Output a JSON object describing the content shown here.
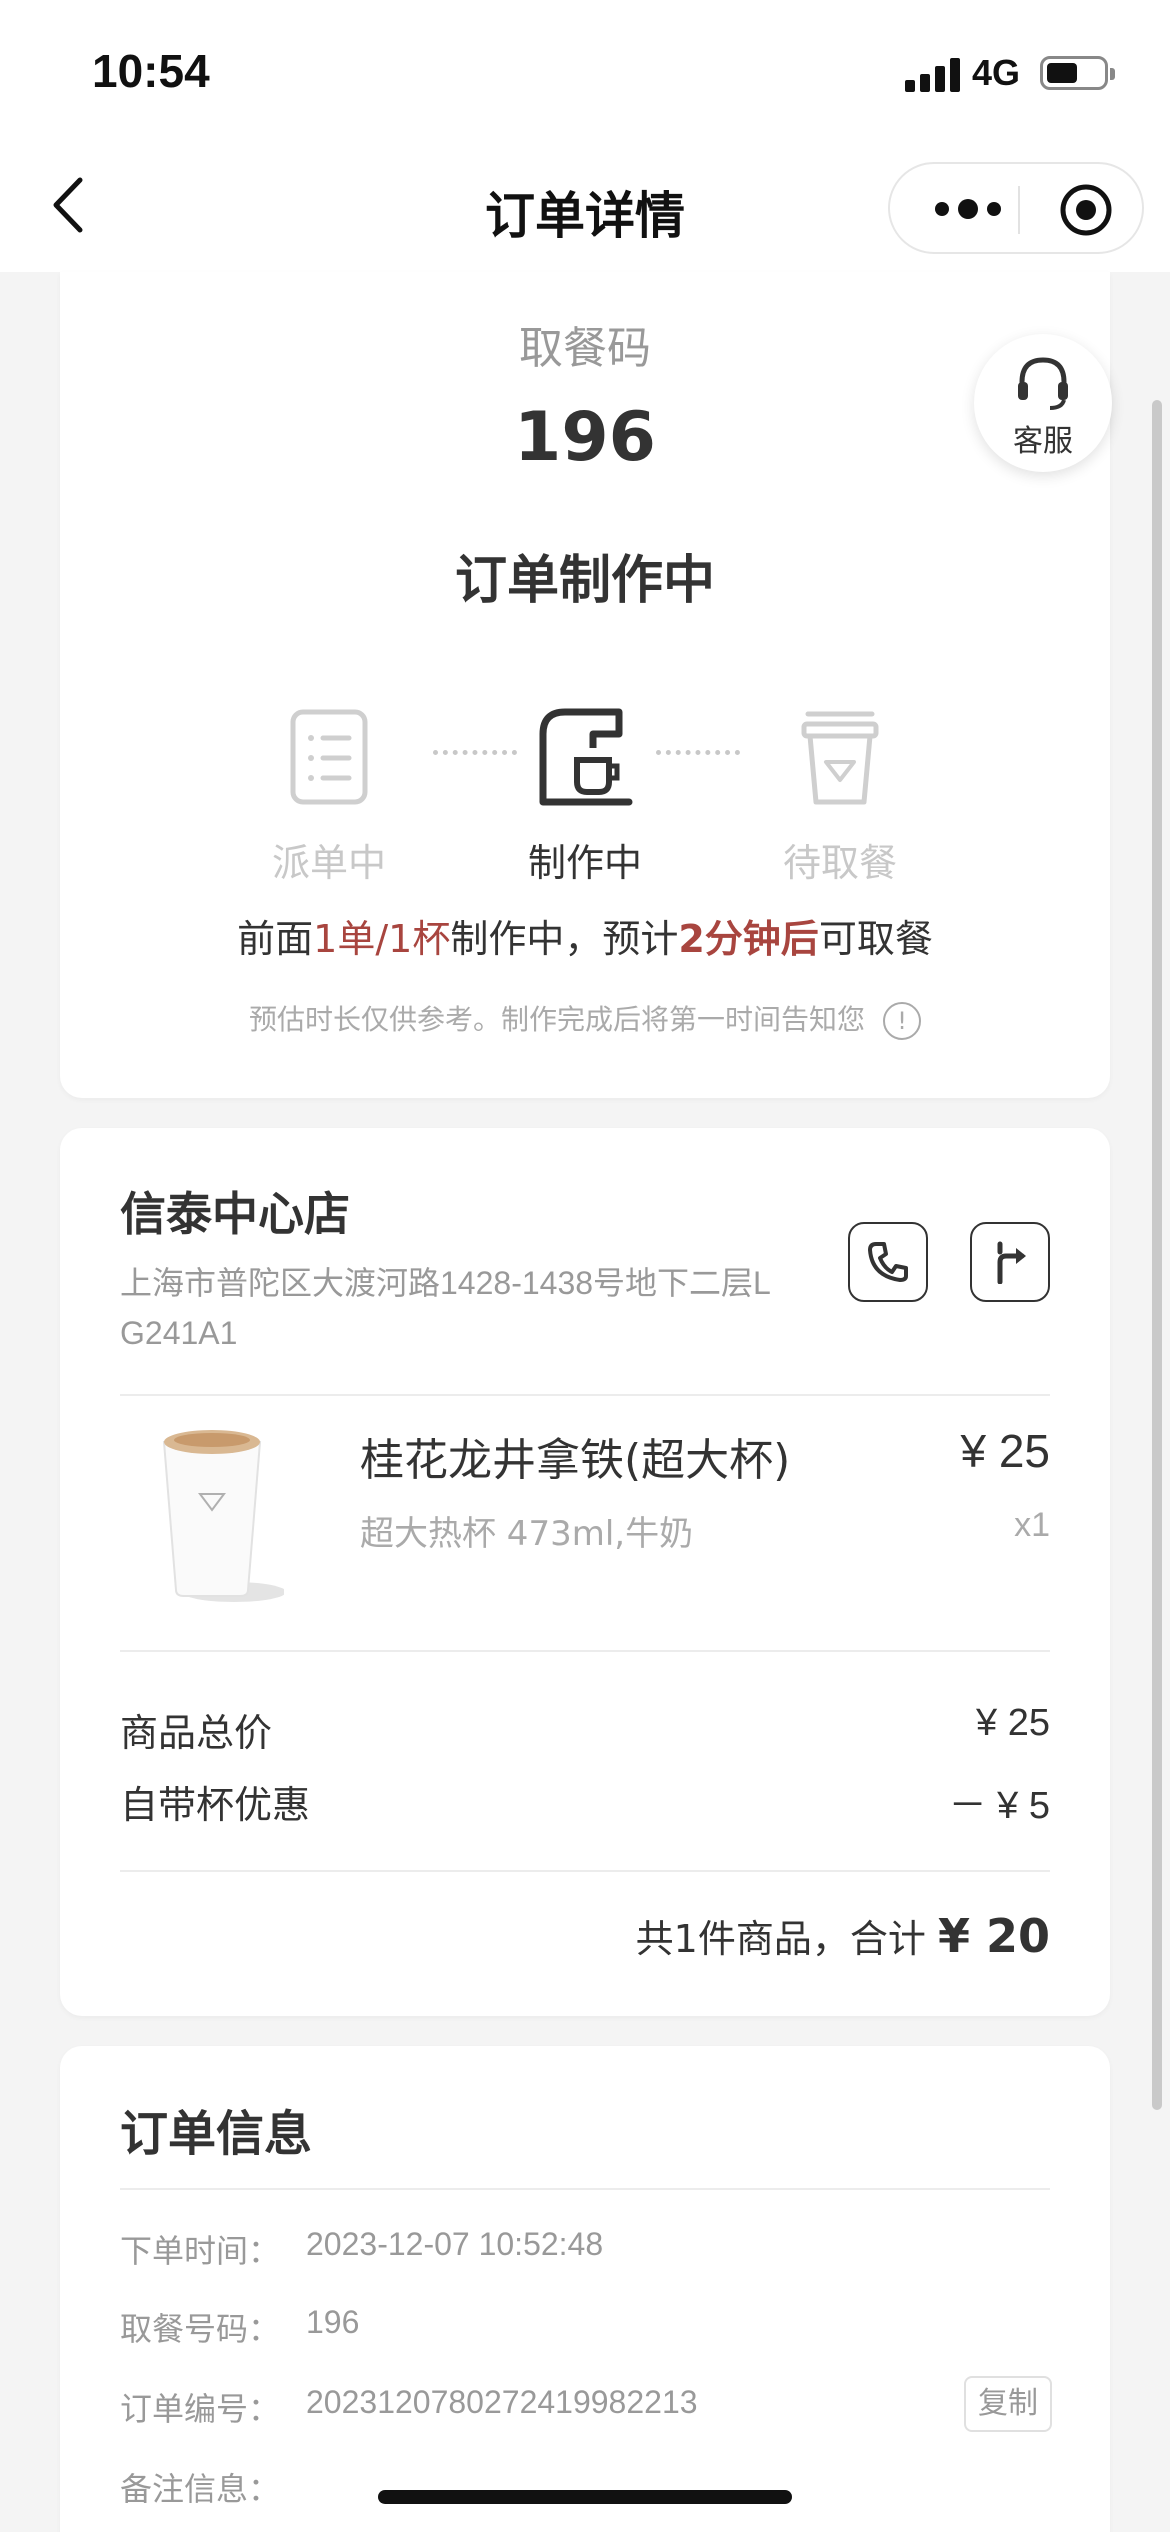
{
  "status_bar": {
    "time": "10:54",
    "network": "4G"
  },
  "nav": {
    "title": "订单详情"
  },
  "pickup": {
    "label": "取餐码",
    "code": "196",
    "status": "订单制作中",
    "steps": [
      {
        "label": "派单中",
        "icon": "order-list-icon",
        "active": false
      },
      {
        "label": "制作中",
        "icon": "coffee-machine-icon",
        "active": true
      },
      {
        "label": "待取餐",
        "icon": "cup-icon",
        "active": false
      }
    ],
    "queue": {
      "prefix": "前面",
      "count": "1单/1杯",
      "mid": "制作中，预计",
      "eta": "2分钟后",
      "suffix": "可取餐"
    },
    "note": "预估时长仅供参考。制作完成后将第一时间告知您"
  },
  "customer_service": {
    "label": "客服",
    "icon": "headset-icon"
  },
  "store": {
    "name": "信泰中心店",
    "address": "上海市普陀区大渡河路1428-1438号地下二层L G241A1",
    "call_icon": "phone-icon",
    "nav_icon": "directions-icon"
  },
  "product": {
    "name": "桂花龙井拿铁(超大杯)",
    "spec": "超大热杯 473ml,牛奶",
    "price": "¥ 25",
    "qty": "x1"
  },
  "summary": {
    "subtotal_label": "商品总价",
    "subtotal_value": "¥ 25",
    "discount_label": "自带杯优惠",
    "discount_value": "－ ¥ 5",
    "total_prefix": "共1件商品，合计",
    "total_amount": "¥ 20"
  },
  "order_info": {
    "title": "订单信息",
    "rows": [
      {
        "label": "下单时间：",
        "value": "2023-12-07 10:52:48"
      },
      {
        "label": "取餐号码：",
        "value": "196"
      },
      {
        "label": "订单编号：",
        "value": "20231207802724199822​13"
      },
      {
        "label": "备注信息：",
        "value": ""
      }
    ],
    "copy_label": "复制"
  },
  "colors": {
    "accent": "#a8453f",
    "muted": "#999999",
    "inactive": "#c8c8c8"
  }
}
